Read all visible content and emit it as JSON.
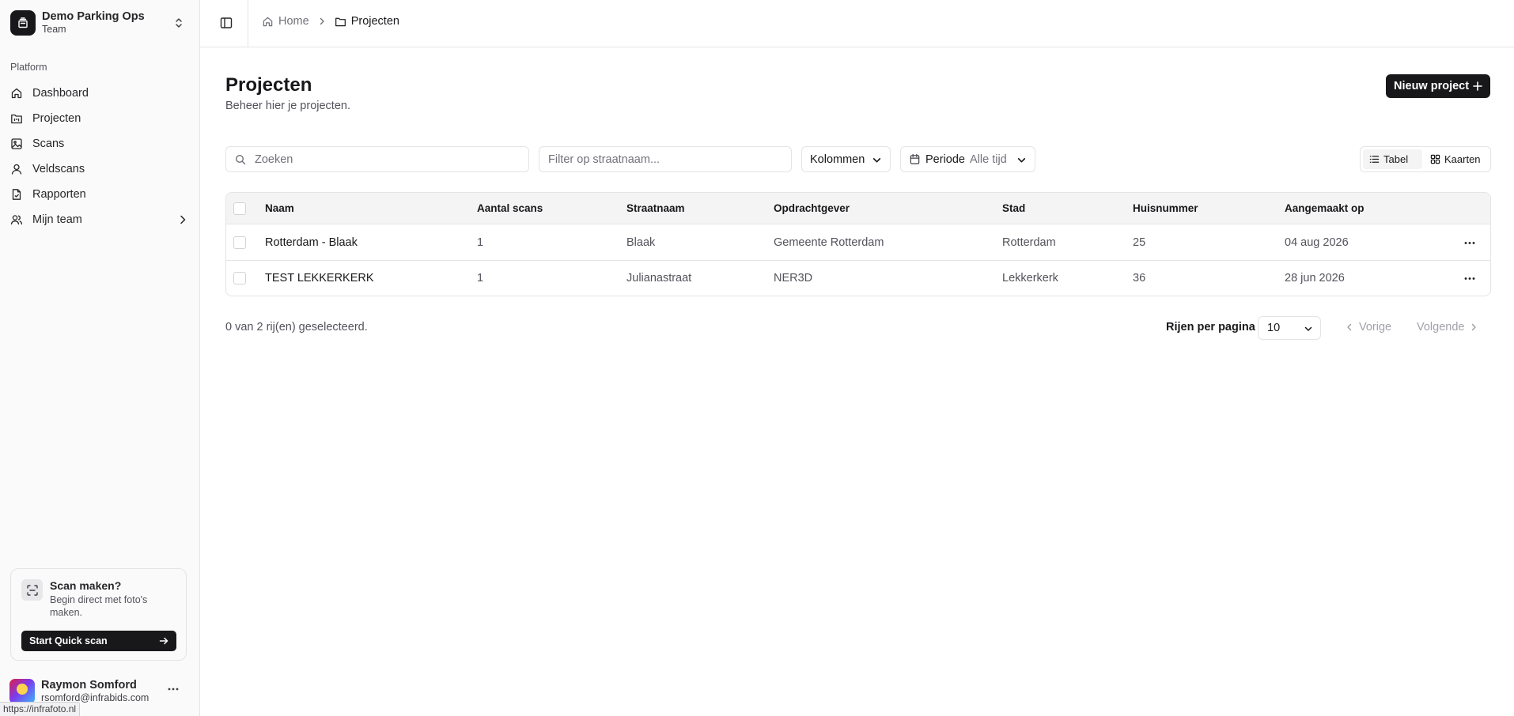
{
  "team": {
    "name": "Demo Parking Ops",
    "plan": "Team"
  },
  "sidebar": {
    "group_label": "Platform",
    "items": [
      {
        "label": "Dashboard",
        "icon": "home-icon"
      },
      {
        "label": "Projecten",
        "icon": "folder-kanban-icon"
      },
      {
        "label": "Scans",
        "icon": "images-icon"
      },
      {
        "label": "Veldscans",
        "icon": "user-scan-icon"
      },
      {
        "label": "Rapporten",
        "icon": "file-report-icon"
      },
      {
        "label": "Mijn team",
        "icon": "users-icon"
      }
    ]
  },
  "promo": {
    "title": "Scan maken?",
    "description": "Begin direct met foto's maken.",
    "button": "Start Quick scan"
  },
  "user": {
    "name": "Raymon Somford",
    "email": "rsomford@infrabids.com"
  },
  "status_url": "https://infrafoto.nl",
  "breadcrumb": {
    "home": "Home",
    "current": "Projecten"
  },
  "page": {
    "title": "Projecten",
    "subtitle": "Beheer hier je projecten.",
    "new_button": "Nieuw project"
  },
  "toolbar": {
    "search_placeholder": "Zoeken",
    "street_placeholder": "Filter op straatnaam...",
    "columns_label": "Kolommen",
    "period_label": "Periode",
    "period_value": "Alle tijd",
    "view_table": "Tabel",
    "view_cards": "Kaarten"
  },
  "table": {
    "columns": [
      "Naam",
      "Aantal scans",
      "Straatnaam",
      "Opdrachtgever",
      "Stad",
      "Huisnummer",
      "Aangemaakt op"
    ],
    "rows": [
      [
        "Rotterdam - Blaak",
        "1",
        "Blaak",
        "Gemeente Rotterdam",
        "Rotterdam",
        "25",
        "04 aug 2026"
      ],
      [
        "TEST LEKKERKERK",
        "1",
        "Julianastraat",
        "NER3D",
        "Lekkerkerk",
        "36",
        "28 jun 2026"
      ]
    ]
  },
  "footer": {
    "selection": "0 van 2 rij(en) geselecteerd.",
    "rows_per_page_label": "Rijen per pagina",
    "rows_per_page_value": "10",
    "prev": "Vorige",
    "next": "Volgende"
  }
}
